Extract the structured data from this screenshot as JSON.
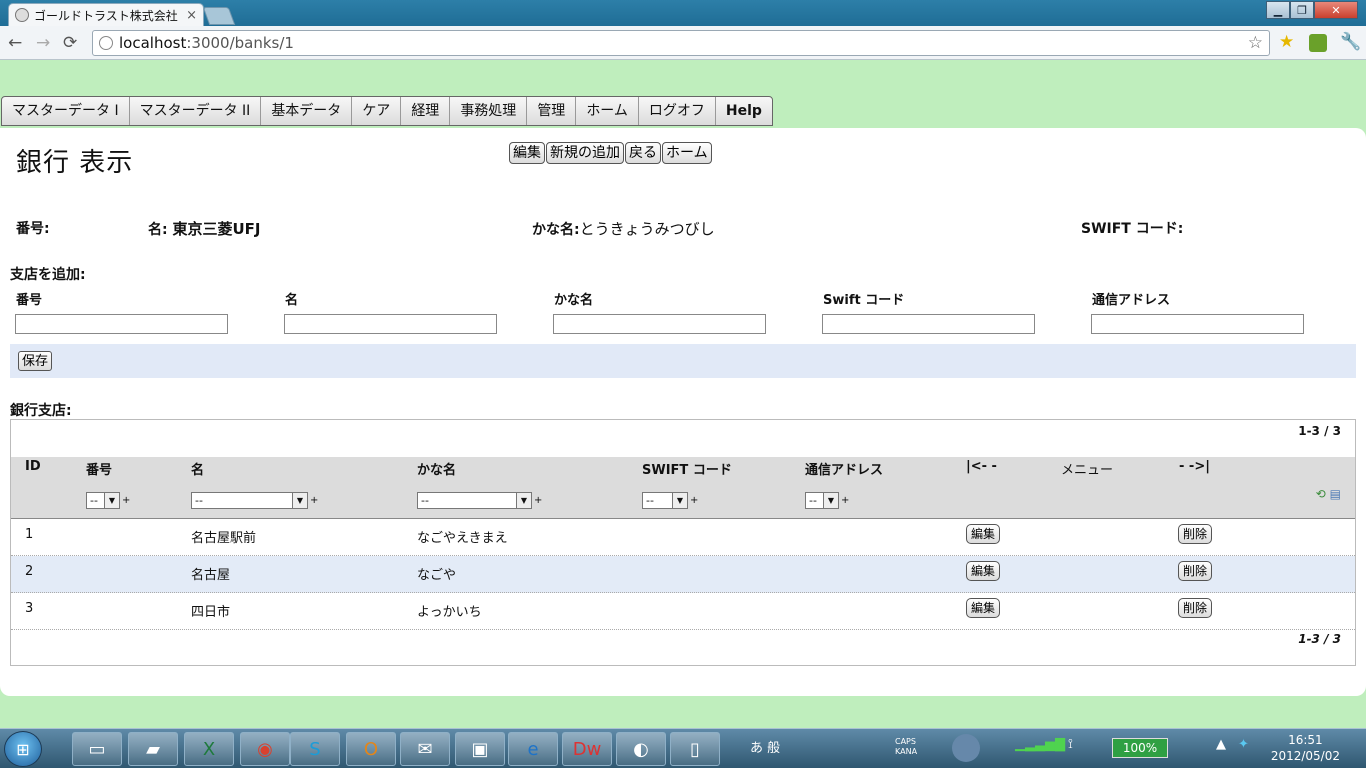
{
  "browser": {
    "tab_title": "ゴールドトラスト株式会社",
    "tab_close": "×",
    "url_host": "localhost",
    "url_path": ":3000/banks/1",
    "back": "←",
    "forward": "→",
    "reload": "⟳",
    "star": "☆",
    "win_min": "▁",
    "win_max": "❐",
    "win_close": "✕"
  },
  "menu": {
    "items": [
      "マスターデータ I",
      "マスターデータ II",
      "基本データ",
      "ケア",
      "経理",
      "事務処理",
      "管理",
      "ホーム",
      "ログオフ",
      "Help"
    ]
  },
  "page": {
    "title": "銀行 表示",
    "actions": [
      "編集",
      "新規の追加",
      "戻る",
      "ホーム"
    ]
  },
  "bank": {
    "number_label": "番号:",
    "name_label": "名:",
    "name_value": "東京三菱UFJ",
    "kana_label": "かな名:",
    "kana_value": "とうきょうみつびし",
    "swift_label": "SWIFT コード:"
  },
  "add_branch": {
    "heading": "支店を追加:",
    "fields": {
      "number": {
        "label": "番号",
        "value": ""
      },
      "name": {
        "label": "名",
        "value": ""
      },
      "kana": {
        "label": "かな名",
        "value": ""
      },
      "swift": {
        "label": "Swift コード",
        "value": ""
      },
      "address": {
        "label": "通信アドレス",
        "value": ""
      }
    },
    "save_label": "保存"
  },
  "branches": {
    "heading": "銀行支店:",
    "pager_top": "1-3 / 3",
    "pager_bottom": "1-3 / 3",
    "columns": {
      "id": "ID",
      "number": "番号",
      "name": "名",
      "kana": "かな名",
      "swift": "SWIFT コード",
      "address": "通信アドレス",
      "first": "|<- -",
      "menu": "メニュー",
      "last": "- ->|"
    },
    "filter_value": "--",
    "plus": "+",
    "rows": [
      {
        "id": "1",
        "name": "名古屋駅前",
        "kana": "なごやえきまえ",
        "edit": "編集",
        "delete": "削除"
      },
      {
        "id": "2",
        "name": "名古屋",
        "kana": "なごや",
        "edit": "編集",
        "delete": "削除"
      },
      {
        "id": "3",
        "name": "四日市",
        "kana": "よっかいち",
        "edit": "編集",
        "delete": "削除"
      }
    ]
  },
  "taskbar": {
    "battery": "100%",
    "time": "16:51",
    "date": "2012/05/02",
    "ime": "あ 般",
    "caps": "CAPS KANA"
  }
}
